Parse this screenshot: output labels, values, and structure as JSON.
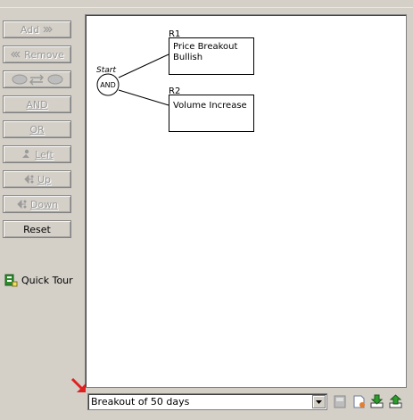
{
  "left_panel": {
    "add_label": "Add",
    "remove_label": "Remove",
    "and_label": "AND",
    "or_label": "OR",
    "left_label": "Left",
    "up_label": "Up",
    "down_label": "Down",
    "reset_label": "Reset",
    "quick_tour_label": "Quick Tour"
  },
  "diagram": {
    "start_label": "Start",
    "root_operator": "AND",
    "rules": [
      {
        "id": "R1",
        "line1": "Price Breakout",
        "line2": "Bullish"
      },
      {
        "id": "R2",
        "line1": "Volume Increase",
        "line2": ""
      }
    ]
  },
  "bottom_bar": {
    "scan_select_value": "Breakout of 50 days"
  },
  "icons": {
    "add_arrows": "double-chevron-right-icon",
    "remove_arrows": "double-chevron-left-icon",
    "swap": "swap-icon",
    "left": "move-left-icon",
    "up": "move-up-icon",
    "down": "move-down-icon",
    "quick_tour": "quick-tour-icon",
    "annotation": "red-arrow-icon"
  },
  "colors": {
    "panel": "#d4d0c8",
    "canvas": "#ffffff",
    "accent_green": "#2e8b2e",
    "annotation_red": "#e02020"
  }
}
